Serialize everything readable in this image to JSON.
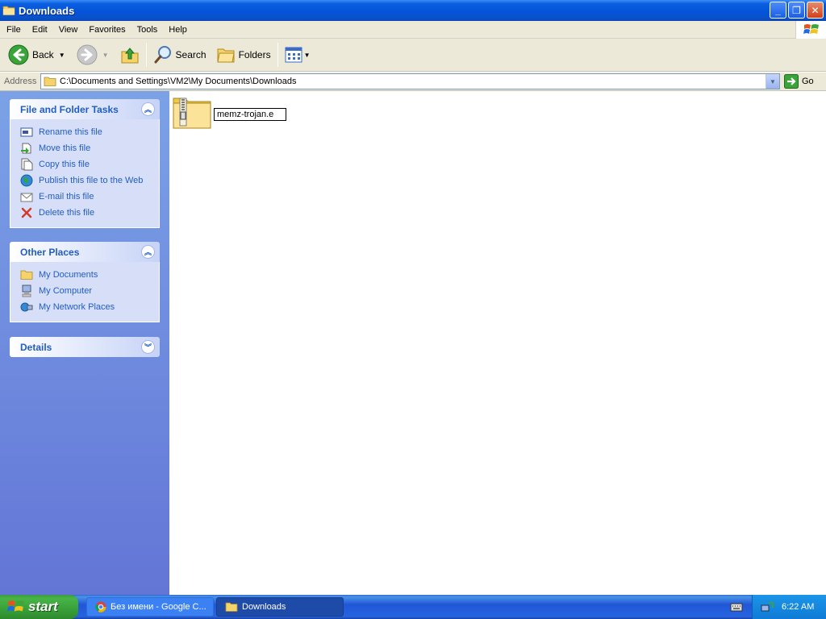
{
  "window": {
    "title": "Downloads",
    "buttons": {
      "minimize": "_",
      "maximize": "❐",
      "close": "✕"
    }
  },
  "menu": {
    "items": [
      "File",
      "Edit",
      "View",
      "Favorites",
      "Tools",
      "Help"
    ]
  },
  "toolbar": {
    "back_label": "Back",
    "search_label": "Search",
    "folders_label": "Folders"
  },
  "address": {
    "label": "Address",
    "value": "C:\\Documents and Settings\\VM2\\My Documents\\Downloads",
    "go_label": "Go"
  },
  "tasks_panel": {
    "title": "File and Folder Tasks",
    "items": [
      {
        "label": "Rename this file",
        "icon": "rename-icon"
      },
      {
        "label": "Move this file",
        "icon": "move-icon"
      },
      {
        "label": "Copy this file",
        "icon": "copy-icon"
      },
      {
        "label": "Publish this file to the Web",
        "icon": "globe-icon"
      },
      {
        "label": "E-mail this file",
        "icon": "email-icon"
      },
      {
        "label": "Delete this file",
        "icon": "delete-icon"
      }
    ]
  },
  "places_panel": {
    "title": "Other Places",
    "items": [
      {
        "label": "My Documents",
        "icon": "folder-icon"
      },
      {
        "label": "My Computer",
        "icon": "computer-icon"
      },
      {
        "label": "My Network Places",
        "icon": "network-icon"
      }
    ]
  },
  "details_panel": {
    "title": "Details"
  },
  "content": {
    "file": {
      "name": "memz-trojan.e",
      "icon": "zip-folder-icon"
    }
  },
  "taskbar": {
    "start_label": "start",
    "tasks": [
      {
        "label": "Без имени - Google C...",
        "icon": "chrome-icon"
      },
      {
        "label": "Downloads",
        "icon": "folder-icon"
      }
    ],
    "clock": "6:22 AM"
  },
  "colors": {
    "title_blue": "#0453d8",
    "panel_link": "#215dc6",
    "start_green": "#38a038"
  }
}
